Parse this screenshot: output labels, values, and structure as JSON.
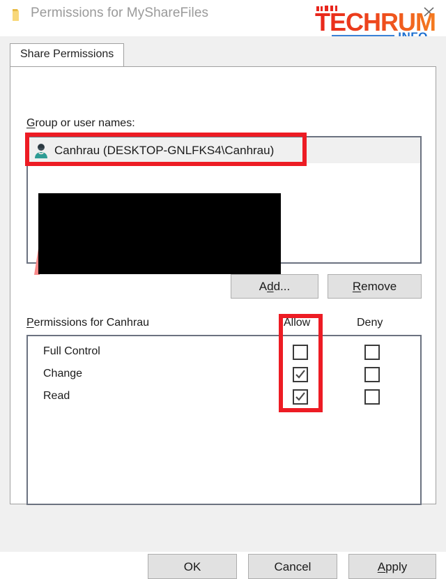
{
  "window": {
    "title": "Permissions for MyShareFiles",
    "folder_icon": "folder-icon",
    "close_label": "close-icon"
  },
  "watermark": {
    "brand": "TECHRUM",
    "suffix": ".INFO",
    "brand_color_start": "#e8251c",
    "brand_color_end": "#f47b20",
    "suffix_color": "#1c6fd0"
  },
  "tabs": [
    {
      "label": "Share Permissions",
      "active": true
    }
  ],
  "group_section": {
    "label_prefix": "G",
    "label_rest": "roup or user names:",
    "users": [
      {
        "name": "Canhrau (DESKTOP-GNLFKS4\\Canhrau)",
        "selected": true,
        "icon": "user-icon"
      }
    ],
    "buttons": {
      "add": {
        "before": "A",
        "accel": "d",
        "after": "d..."
      },
      "remove": {
        "accel": "R",
        "after": "emove"
      }
    }
  },
  "permissions_section": {
    "label_prefix": "P",
    "label_rest": "ermissions for Canhrau",
    "columns": {
      "allow": "Allow",
      "deny": "Deny"
    },
    "rows": [
      {
        "name": "Full Control",
        "allow": false,
        "deny": false
      },
      {
        "name": "Change",
        "allow": true,
        "deny": false
      },
      {
        "name": "Read",
        "allow": true,
        "deny": false
      }
    ]
  },
  "dialog_buttons": {
    "ok": "OK",
    "cancel": "Cancel",
    "apply": {
      "accel": "A",
      "after": "pply"
    }
  },
  "annotations": {
    "color": "#ed1c24",
    "boxes": [
      {
        "target": "selected-user-row"
      },
      {
        "target": "allow-checkbox-column"
      }
    ],
    "redaction_color": "#000000"
  }
}
